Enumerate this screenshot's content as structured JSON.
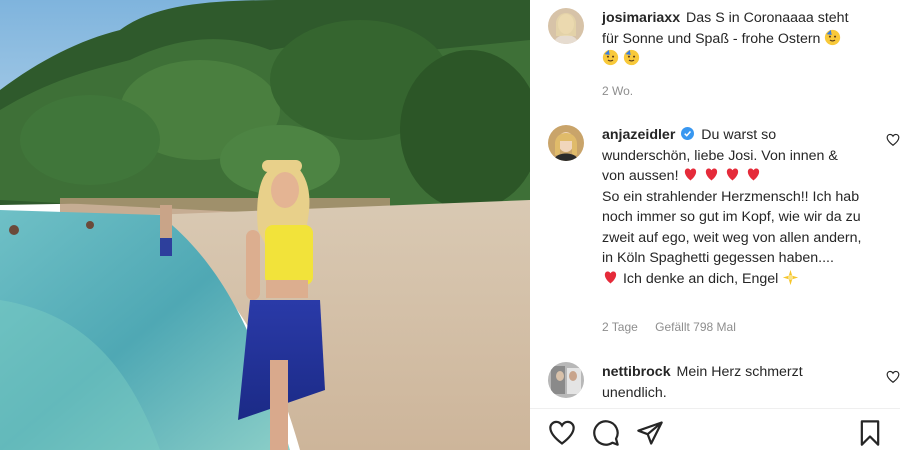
{
  "caption": {
    "username": "josimariaxx",
    "text": "Das S in Coronaaaa steht für Sonne und Spaß - frohe Ostern",
    "time": "2 Wo."
  },
  "comments": [
    {
      "username": "anjazeidler",
      "verified": true,
      "text_1": "Du warst so wunderschön, liebe Josi. Von innen & von aussen!",
      "text_2": "So ein strahlender Herzmensch!! Ich hab noch immer so gut im Kopf, wie wir da zu zweit auf ego, weit weg von allen andern, in Köln Spaghetti gegessen haben....",
      "text_3": "Ich denke an dich, Engel",
      "time": "2 Tage",
      "likes": "Gefällt 798 Mal"
    },
    {
      "username": "nettibrock",
      "text": "Mein Herz schmerzt unendlich."
    }
  ],
  "icons": {
    "like": "heart-icon",
    "comment": "comment-icon",
    "share": "share-icon",
    "save": "bookmark-icon",
    "verified": "verified-badge-icon",
    "emoji_celebrate": "partying-face-emoji",
    "emoji_heart": "red-heart-emoji",
    "emoji_sparkle": "angel-sparkle-emoji"
  },
  "colors": {
    "username": "#262626",
    "meta": "#8e8e8e",
    "verified": "#3897f0",
    "heart": "#ed4956"
  }
}
